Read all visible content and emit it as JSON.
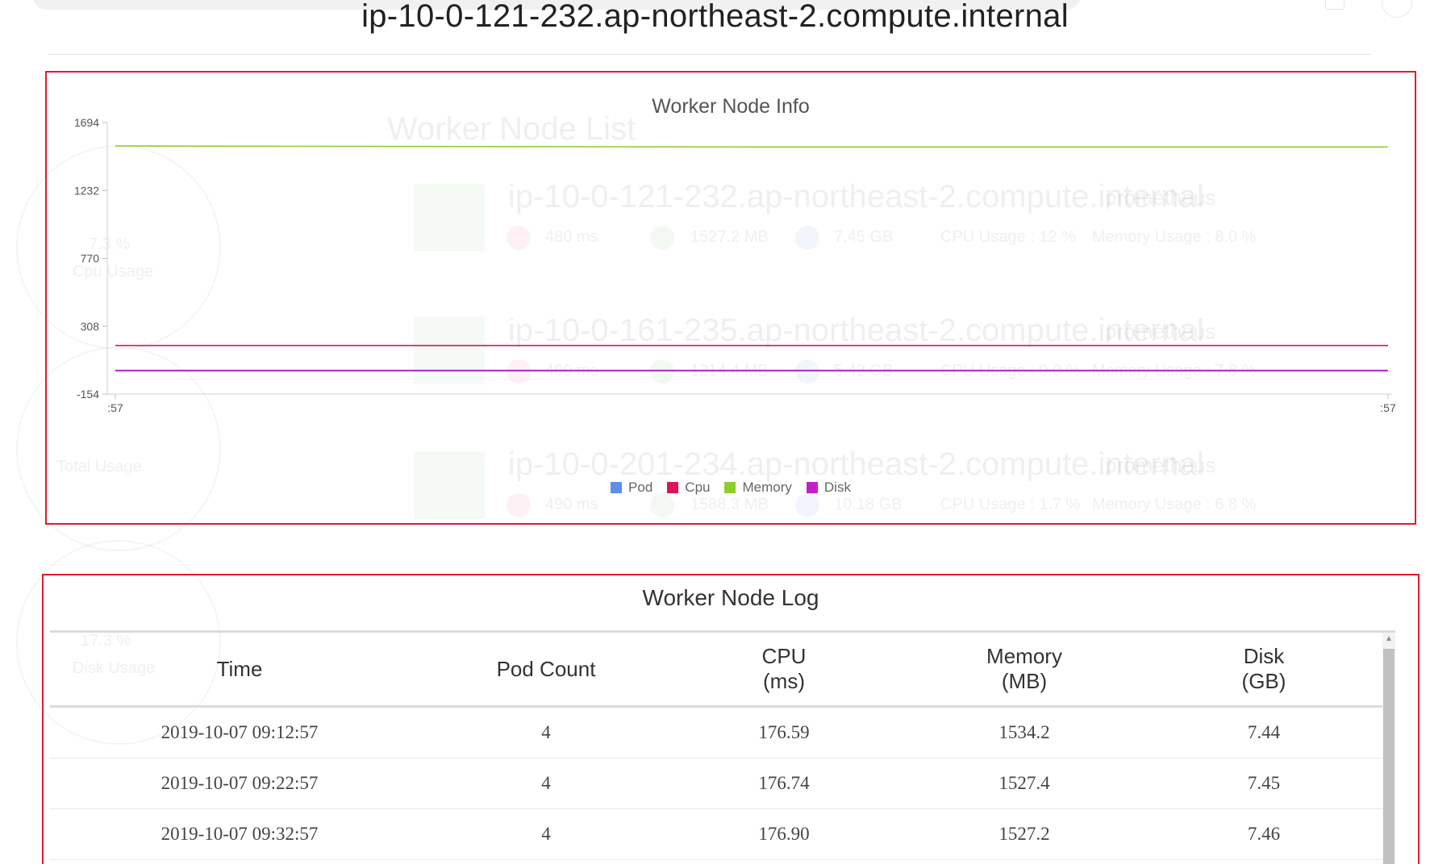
{
  "node": {
    "title": "ip-10-0-121-232.ap-northeast-2.compute.internal"
  },
  "background": {
    "list_title": "Worker Node List",
    "rows": [
      {
        "name": "ip-10-0-121-232.ap-northeast-2.compute.internal",
        "tag": "prometheus",
        "cpu": "480 ms",
        "memory": "1527.2 MB",
        "disk": "7.45 GB",
        "cpu_usage": "CPU Usage : 12 %",
        "memory_usage": "Memory Usage : 8.0 %"
      },
      {
        "name": "ip-10-0-161-235.ap-northeast-2.compute.internal",
        "tag": "prometheus",
        "cpu": "490 ms",
        "memory": "1214.4 MB",
        "disk": "5.42 GB",
        "cpu_usage": "CPU Usage : 0.0 %",
        "memory_usage": "Memory Usage : 7.8 %"
      },
      {
        "name": "ip-10-0-201-234.ap-northeast-2.compute.internal",
        "tag": "prometheus",
        "cpu": "490 ms",
        "memory": "1588.3 MB",
        "disk": "10.18 GB",
        "cpu_usage": "CPU Usage : 1.7 %",
        "memory_usage": "Memory Usage : 6.8 %"
      }
    ],
    "gauges": [
      {
        "value": "7.3 %",
        "label": "Cpu Usage"
      },
      {
        "value": "Total Usage",
        "label": ""
      },
      {
        "value": "17.3 %",
        "label": "Disk Usage"
      }
    ]
  },
  "info_panel": {
    "title": "Worker Node Info"
  },
  "chart_data": {
    "type": "line",
    "title": "Worker Node Info",
    "x": [
      ":57",
      ":57"
    ],
    "y_ticks": [
      1694,
      1232,
      770,
      308,
      -154
    ],
    "ylim": [
      -154,
      1694
    ],
    "grid": false,
    "legend_position": "bottom",
    "series": [
      {
        "name": "Pod",
        "color": "#5c8fe8",
        "values": [
          4,
          4,
          4
        ]
      },
      {
        "name": "Cpu",
        "color": "#e0125a",
        "values": [
          176.59,
          176.74,
          176.9
        ]
      },
      {
        "name": "Memory",
        "color": "#8ccf2c",
        "values": [
          1534.2,
          1527.4,
          1527.2
        ]
      },
      {
        "name": "Disk",
        "color": "#c41ec8",
        "values": [
          7.44,
          7.45,
          7.46
        ]
      }
    ]
  },
  "log_panel": {
    "title": "Worker Node Log",
    "columns": [
      {
        "label": "Time",
        "unit": ""
      },
      {
        "label": "Pod Count",
        "unit": ""
      },
      {
        "label": "CPU",
        "unit": "(ms)"
      },
      {
        "label": "Memory",
        "unit": "(MB)"
      },
      {
        "label": "Disk",
        "unit": "(GB)"
      }
    ],
    "rows": [
      [
        "2019-10-07 09:12:57",
        "4",
        "176.59",
        "1534.2",
        "7.44"
      ],
      [
        "2019-10-07 09:22:57",
        "4",
        "176.74",
        "1527.4",
        "7.45"
      ],
      [
        "2019-10-07 09:32:57",
        "4",
        "176.90",
        "1527.2",
        "7.46"
      ]
    ]
  }
}
